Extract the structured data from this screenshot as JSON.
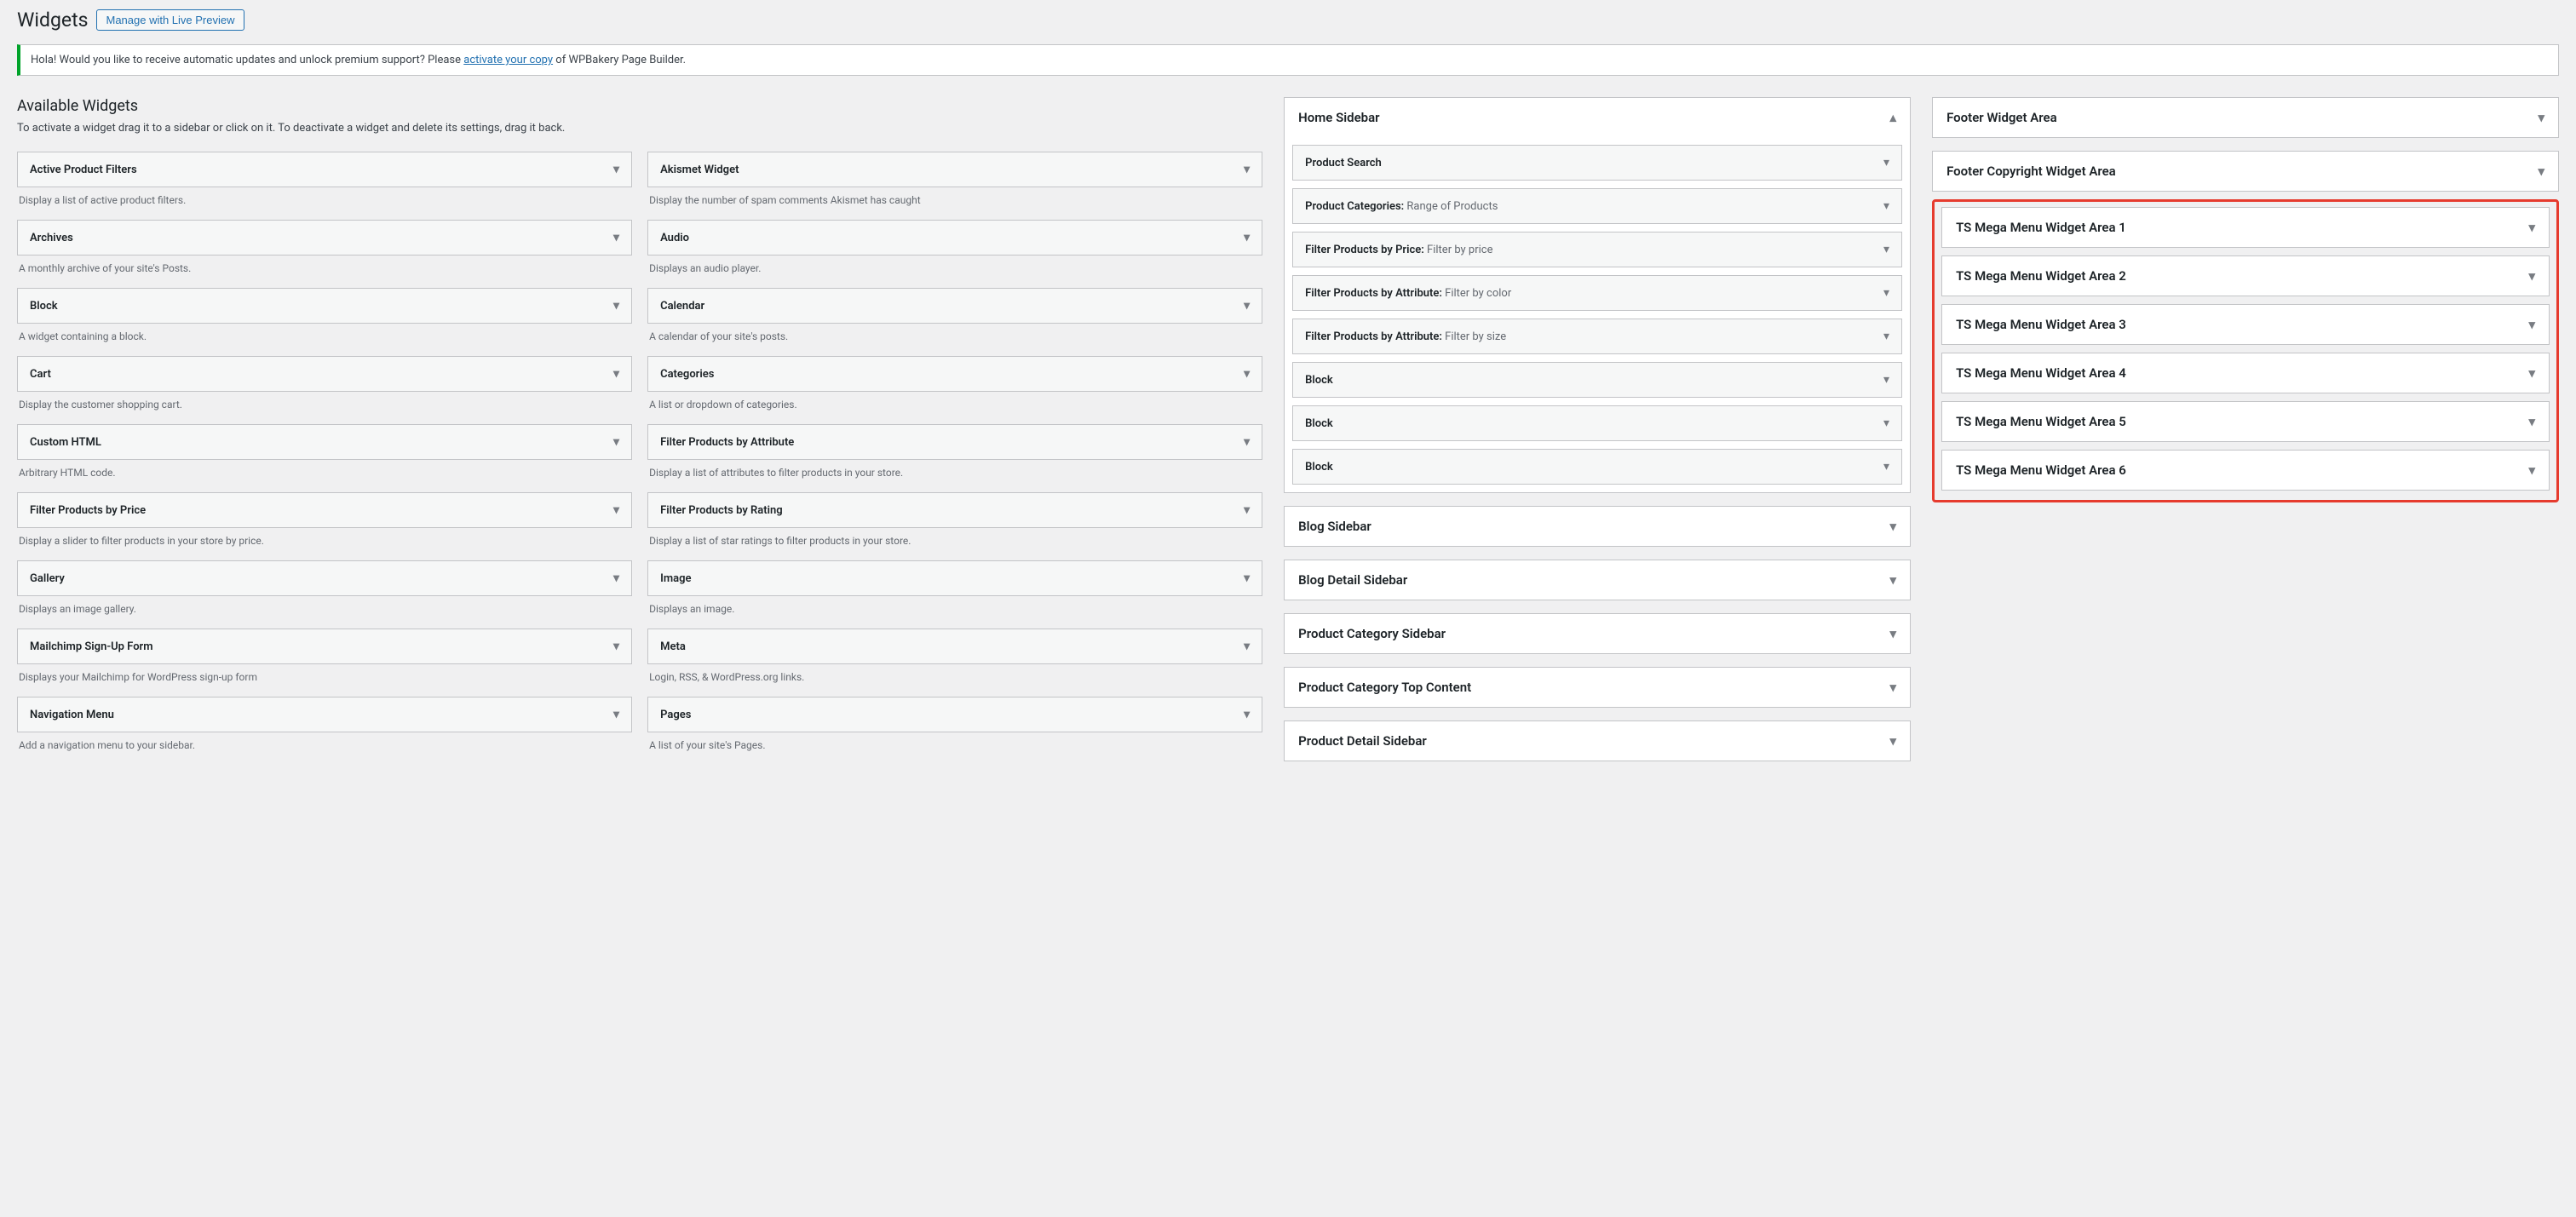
{
  "header": {
    "title": "Widgets",
    "manage_button": "Manage with Live Preview"
  },
  "notice": {
    "prefix": "Hola! Would you like to receive automatic updates and unlock premium support? Please ",
    "link": "activate your copy",
    "suffix": " of WPBakery Page Builder."
  },
  "available": {
    "title": "Available Widgets",
    "description": "To activate a widget drag it to a sidebar or click on it. To deactivate a widget and delete its settings, drag it back.",
    "left_col": [
      {
        "name": "Active Product Filters",
        "desc": "Display a list of active product filters."
      },
      {
        "name": "Archives",
        "desc": "A monthly archive of your site's Posts."
      },
      {
        "name": "Block",
        "desc": "A widget containing a block."
      },
      {
        "name": "Cart",
        "desc": "Display the customer shopping cart."
      },
      {
        "name": "Custom HTML",
        "desc": "Arbitrary HTML code."
      },
      {
        "name": "Filter Products by Price",
        "desc": "Display a slider to filter products in your store by price."
      },
      {
        "name": "Gallery",
        "desc": "Displays an image gallery."
      },
      {
        "name": "Mailchimp Sign-Up Form",
        "desc": "Displays your Mailchimp for WordPress sign-up form"
      },
      {
        "name": "Navigation Menu",
        "desc": "Add a navigation menu to your sidebar."
      }
    ],
    "right_col": [
      {
        "name": "Akismet Widget",
        "desc": "Display the number of spam comments Akismet has caught"
      },
      {
        "name": "Audio",
        "desc": "Displays an audio player."
      },
      {
        "name": "Calendar",
        "desc": "A calendar of your site's posts."
      },
      {
        "name": "Categories",
        "desc": "A list or dropdown of categories."
      },
      {
        "name": "Filter Products by Attribute",
        "desc": "Display a list of attributes to filter products in your store."
      },
      {
        "name": "Filter Products by Rating",
        "desc": "Display a list of star ratings to filter products in your store."
      },
      {
        "name": "Image",
        "desc": "Displays an image."
      },
      {
        "name": "Meta",
        "desc": "Login, RSS, & WordPress.org links."
      },
      {
        "name": "Pages",
        "desc": "A list of your site's Pages."
      }
    ]
  },
  "sidebars_mid": {
    "home": {
      "title": "Home Sidebar",
      "widgets": [
        {
          "label": "Product Search",
          "subtitle": ""
        },
        {
          "label": "Product Categories:",
          "subtitle": " Range of Products"
        },
        {
          "label": "Filter Products by Price:",
          "subtitle": " Filter by price"
        },
        {
          "label": "Filter Products by Attribute:",
          "subtitle": " Filter by color"
        },
        {
          "label": "Filter Products by Attribute:",
          "subtitle": " Filter by size"
        },
        {
          "label": "Block",
          "subtitle": ""
        },
        {
          "label": "Block",
          "subtitle": ""
        },
        {
          "label": "Block",
          "subtitle": ""
        }
      ]
    },
    "others": [
      "Blog Sidebar",
      "Blog Detail Sidebar",
      "Product Category Sidebar",
      "Product Category Top Content",
      "Product Detail Sidebar"
    ]
  },
  "sidebars_right": {
    "normal": [
      "Footer Widget Area",
      "Footer Copyright Widget Area"
    ],
    "highlighted": [
      "TS Mega Menu Widget Area 1",
      "TS Mega Menu Widget Area 2",
      "TS Mega Menu Widget Area 3",
      "TS Mega Menu Widget Area 4",
      "TS Mega Menu Widget Area 5",
      "TS Mega Menu Widget Area 6"
    ]
  }
}
